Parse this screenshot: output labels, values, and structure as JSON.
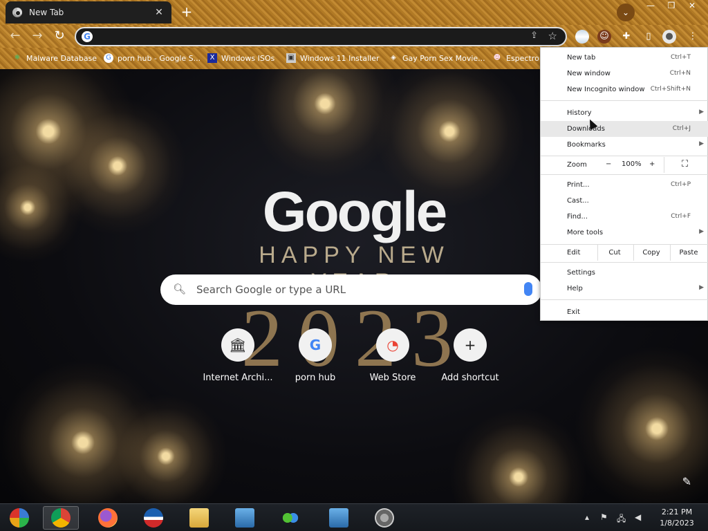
{
  "browser": {
    "tab_title": "New Tab",
    "tab_close": "✕",
    "new_tab": "+",
    "window_controls": {
      "minimize": "—",
      "restore": "❐",
      "close": "✕"
    },
    "omnibox": {
      "value": "",
      "icon": "G"
    }
  },
  "bookmarks": [
    {
      "label": "Malware Database",
      "icon": "bug-icon"
    },
    {
      "label": "porn hub - Google S...",
      "icon": "google-icon"
    },
    {
      "label": "Windows ISOs",
      "icon": "x-icon"
    },
    {
      "label": "Windows 11 Installer",
      "icon": "installer-icon"
    },
    {
      "label": "Gay Porn Sex Movie...",
      "icon": "site-icon"
    },
    {
      "label": "Espectro",
      "icon": "face-icon"
    }
  ],
  "newtab": {
    "logo": "Google",
    "doodle_line1": "HAPPY NEW YEAR",
    "doodle_year": "2023",
    "search_placeholder": "Search Google or type a URL",
    "shortcuts": [
      {
        "label": "Internet Archi...",
        "glyph": "🏛"
      },
      {
        "label": "porn hub",
        "glyph": "G"
      },
      {
        "label": "Web Store",
        "glyph": "◔"
      },
      {
        "label": "Add shortcut",
        "glyph": "+"
      }
    ]
  },
  "menu": {
    "new_tab": {
      "label": "New tab",
      "shortcut": "Ctrl+T"
    },
    "new_window": {
      "label": "New window",
      "shortcut": "Ctrl+N"
    },
    "incognito": {
      "label": "New Incognito window",
      "shortcut": "Ctrl+Shift+N"
    },
    "history": {
      "label": "History"
    },
    "downloads": {
      "label": "Downloads",
      "shortcut": "Ctrl+J"
    },
    "bookmarks": {
      "label": "Bookmarks"
    },
    "zoom": {
      "label": "Zoom",
      "minus": "−",
      "value": "100%",
      "plus": "+",
      "fullscreen": "⛶"
    },
    "print": {
      "label": "Print...",
      "shortcut": "Ctrl+P"
    },
    "cast": {
      "label": "Cast..."
    },
    "find": {
      "label": "Find...",
      "shortcut": "Ctrl+F"
    },
    "more_tools": {
      "label": "More tools"
    },
    "edit": {
      "label": "Edit",
      "cut": "Cut",
      "copy": "Copy",
      "paste": "Paste"
    },
    "settings": {
      "label": "Settings"
    },
    "help": {
      "label": "Help"
    },
    "exit": {
      "label": "Exit"
    }
  },
  "taskbar": {
    "time": "2:21 PM",
    "date": "1/8/2023"
  }
}
